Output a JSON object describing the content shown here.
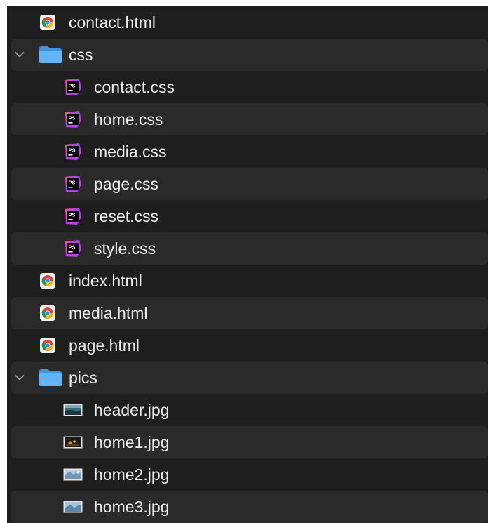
{
  "files": [
    {
      "label": "contact.html",
      "type": "html",
      "level": 0
    },
    {
      "label": "css",
      "type": "folder",
      "level": 0,
      "expanded": true
    },
    {
      "label": "contact.css",
      "type": "css",
      "level": 1
    },
    {
      "label": "home.css",
      "type": "css",
      "level": 1
    },
    {
      "label": "media.css",
      "type": "css",
      "level": 1
    },
    {
      "label": "page.css",
      "type": "css",
      "level": 1
    },
    {
      "label": "reset.css",
      "type": "css",
      "level": 1
    },
    {
      "label": "style.css",
      "type": "css",
      "level": 1
    },
    {
      "label": "index.html",
      "type": "html",
      "level": 0
    },
    {
      "label": "media.html",
      "type": "html",
      "level": 0
    },
    {
      "label": "page.html",
      "type": "html",
      "level": 0
    },
    {
      "label": "pics",
      "type": "folder",
      "level": 0,
      "expanded": true
    },
    {
      "label": "header.jpg",
      "type": "image",
      "level": 1
    },
    {
      "label": "home1.jpg",
      "type": "image",
      "level": 1
    },
    {
      "label": "home2.jpg",
      "type": "image",
      "level": 1
    },
    {
      "label": "home3.jpg",
      "type": "image",
      "level": 1
    }
  ],
  "colors": {
    "background": "#1e1e1e",
    "alt_row": "#2a2a2a",
    "text": "#ececec",
    "folder": "#5aaef0",
    "ps_badge": "#a23fd6"
  }
}
